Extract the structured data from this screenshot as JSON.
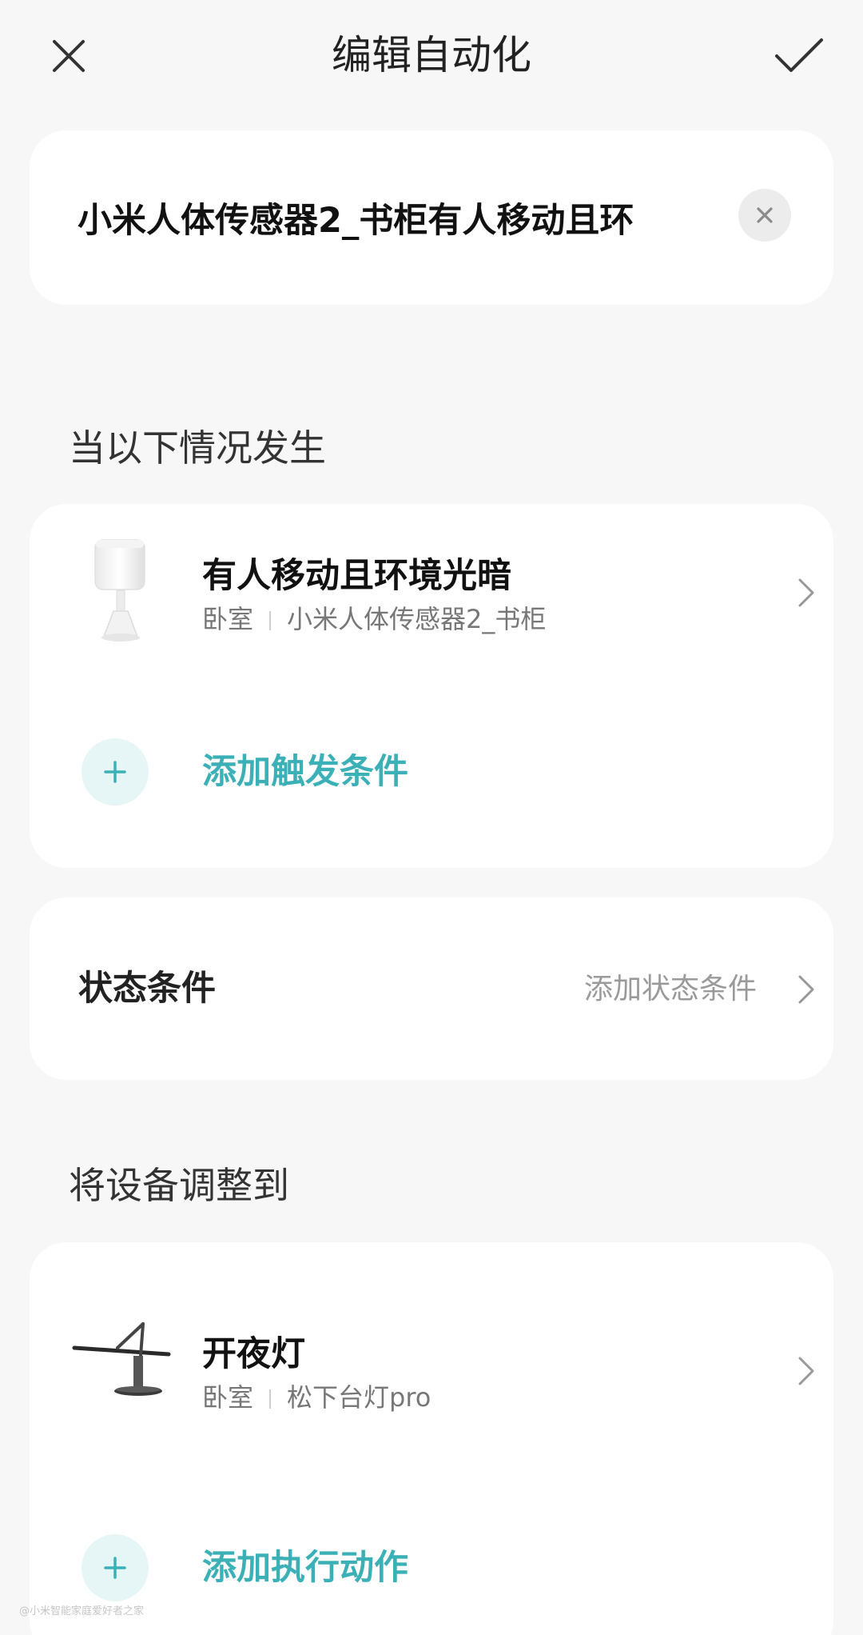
{
  "header": {
    "title": "编辑自动化"
  },
  "name_field": {
    "value": "小米人体传感器2_书柜有人移动且环"
  },
  "trigger_section": {
    "label": "当以下情况发生",
    "items": [
      {
        "title": "有人移动且环境光暗",
        "room": "卧室",
        "device": "小米人体传感器2_书柜"
      }
    ],
    "add_label": "添加触发条件"
  },
  "state_section": {
    "title": "状态条件",
    "action_label": "添加状态条件"
  },
  "action_section": {
    "label": "将设备调整到",
    "items": [
      {
        "title": "开夜灯",
        "room": "卧室",
        "device": "松下台灯pro"
      }
    ],
    "add_label": "添加执行动作"
  },
  "watermark": "@小米智能家庭爱好者之家",
  "colors": {
    "accent": "#3bb0b6",
    "accent_bg": "#e6f6f7",
    "page_bg": "#f7f7f7",
    "card_bg": "#ffffff"
  },
  "icons": [
    "close-icon",
    "check-icon",
    "clear-icon",
    "chevron-right-icon",
    "plus-icon",
    "motion-sensor-image",
    "desk-lamp-image"
  ]
}
